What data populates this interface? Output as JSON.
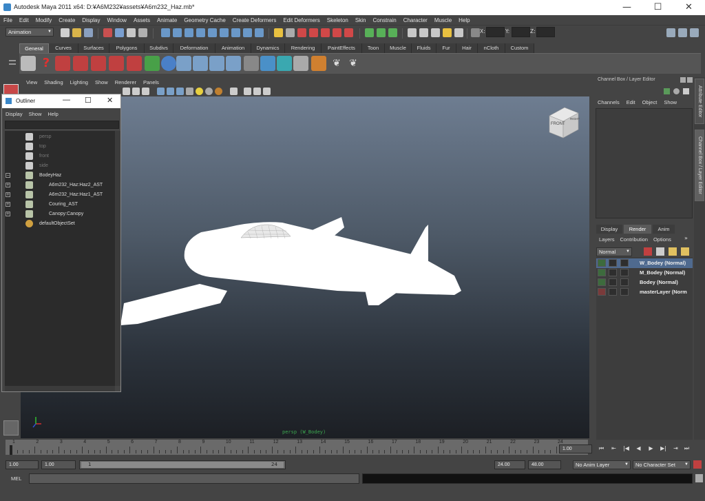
{
  "window": {
    "title": "Autodesk Maya 2011 x64: D:¥A6M232¥assets¥A6m232_Haz.mb*",
    "minimize": "—",
    "maximize": "☐",
    "close": "✕"
  },
  "menubar": [
    "File",
    "Edit",
    "Modify",
    "Create",
    "Display",
    "Window",
    "Assets",
    "Animate",
    "Geometry Cache",
    "Create Deformers",
    "Edit Deformers",
    "Skeleton",
    "Skin",
    "Constrain",
    "Character",
    "Muscle",
    "Help"
  ],
  "statusline": {
    "menuset": "Animation",
    "x_label": "X:",
    "y_label": "Y:",
    "z_label": "Z:"
  },
  "shelf": {
    "tabs": [
      "General",
      "Curves",
      "Surfaces",
      "Polygons",
      "Subdivs",
      "Deformation",
      "Animation",
      "Dynamics",
      "Rendering",
      "PaintEffects",
      "Toon",
      "Muscle",
      "Fluids",
      "Fur",
      "Hair",
      "nCloth",
      "Custom"
    ],
    "active_tab": "General"
  },
  "panel": {
    "menu": [
      "View",
      "Shading",
      "Lighting",
      "Show",
      "Renderer",
      "Panels"
    ],
    "camera_label": "persp (W_Bodey)",
    "viewcube_front": "FRONT",
    "viewcube_right": "RIGHT"
  },
  "outliner": {
    "title": "Outliner",
    "menu": [
      "Display",
      "Show",
      "Help"
    ],
    "items": [
      {
        "label": "persp",
        "dim": true
      },
      {
        "label": "top",
        "dim": true
      },
      {
        "label": "front",
        "dim": true
      },
      {
        "label": "side",
        "dim": true
      },
      {
        "label": "BodeyHaz",
        "dim": false
      },
      {
        "label": "A6m232_Haz:Haz2_AST",
        "dim": false
      },
      {
        "label": "A6m232_Haz:Haz1_AST",
        "dim": false
      },
      {
        "label": "Couring_AST",
        "dim": false
      },
      {
        "label": "Canopy:Canopy",
        "dim": false
      },
      {
        "label": "defaultObjectSet",
        "dim": false
      }
    ]
  },
  "channelbox": {
    "title": "Channel Box / Layer Editor",
    "menu": [
      "Channels",
      "Edit",
      "Object",
      "Show"
    ],
    "side_tabs": [
      "Attribute Editor",
      "Channel Box / Layer Editor"
    ],
    "layer_tabs": [
      "Display",
      "Render",
      "Anim"
    ],
    "active_layer_tab": "Render",
    "layer_menu": [
      "Layers",
      "Contribution",
      "Options"
    ],
    "blend_mode": "Normal",
    "layers": [
      {
        "name": "W_Bodey (Normal)",
        "selected": true
      },
      {
        "name": "M_Bodey (Normal)",
        "selected": false
      },
      {
        "name": "Bodey (Normal)",
        "selected": false
      },
      {
        "name": "masterLayer (Norm",
        "selected": false
      }
    ]
  },
  "timeslider": {
    "ticks": [
      "1",
      "2",
      "3",
      "4",
      "5",
      "6",
      "7",
      "8",
      "9",
      "10",
      "11",
      "12",
      "13",
      "14",
      "15",
      "16",
      "17",
      "18",
      "19",
      "20",
      "21",
      "22",
      "23",
      "24"
    ],
    "current_frame": "1.00"
  },
  "rangeslider": {
    "start_time": "1.00",
    "start_range": "1.00",
    "range_min_label": "1",
    "range_max_label": "24",
    "end_range": "24.00",
    "end_time": "48.00",
    "anim_layer": "No Anim Layer",
    "character_set": "No Character Set"
  },
  "mel": {
    "label": "MEL"
  }
}
